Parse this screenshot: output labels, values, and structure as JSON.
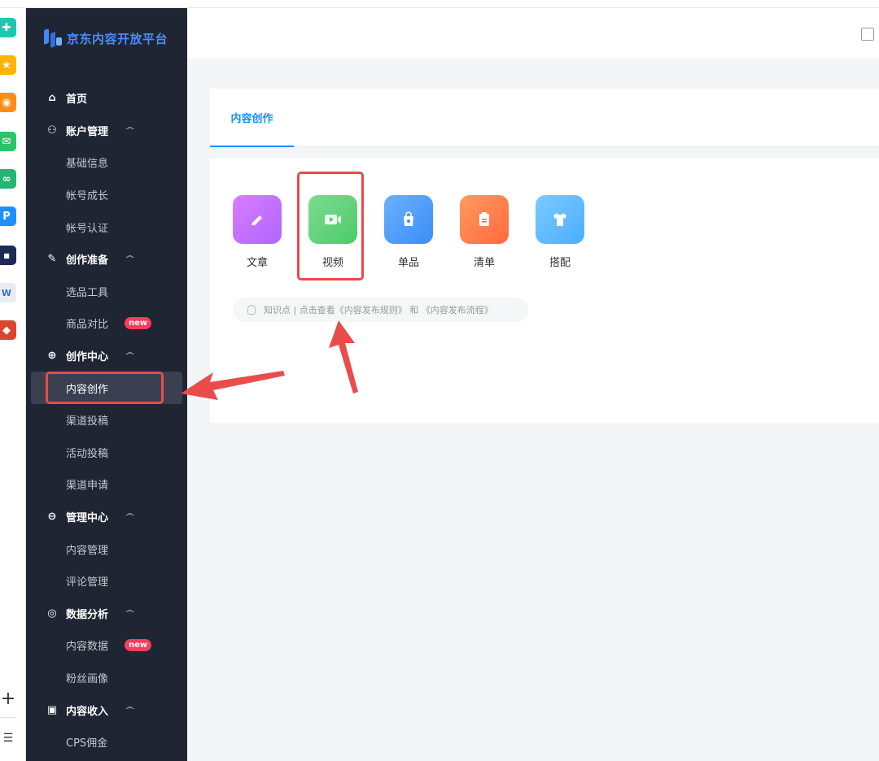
{
  "sidebar": {
    "logo_text": "京东内容开放平台",
    "nav": [
      {
        "type": "group",
        "label": "首页",
        "icon": "home-icon",
        "chevron": false
      },
      {
        "type": "group",
        "label": "账户管理",
        "icon": "user-icon",
        "chevron": true
      },
      {
        "type": "sub",
        "label": "基础信息"
      },
      {
        "type": "sub",
        "label": "帐号成长"
      },
      {
        "type": "sub",
        "label": "帐号认证"
      },
      {
        "type": "group",
        "label": "创作准备",
        "icon": "pen-icon",
        "chevron": true
      },
      {
        "type": "sub",
        "label": "选品工具"
      },
      {
        "type": "sub",
        "label": "商品对比",
        "badge": "new"
      },
      {
        "type": "group",
        "label": "创作中心",
        "icon": "plus-circle-icon",
        "chevron": true
      },
      {
        "type": "sub",
        "label": "内容创作",
        "active": true
      },
      {
        "type": "sub",
        "label": "渠道投稿"
      },
      {
        "type": "sub",
        "label": "活动投稿"
      },
      {
        "type": "sub",
        "label": "渠道申请"
      },
      {
        "type": "group",
        "label": "管理中心",
        "icon": "chat-icon",
        "chevron": true
      },
      {
        "type": "sub",
        "label": "内容管理"
      },
      {
        "type": "sub",
        "label": "评论管理"
      },
      {
        "type": "group",
        "label": "数据分析",
        "icon": "target-icon",
        "chevron": true
      },
      {
        "type": "sub",
        "label": "内容数据",
        "badge": "new"
      },
      {
        "type": "sub",
        "label": "粉丝画像"
      },
      {
        "type": "group",
        "label": "内容收入",
        "icon": "wallet-icon",
        "chevron": true
      },
      {
        "type": "sub",
        "label": "CPS佣金"
      }
    ]
  },
  "main": {
    "tab_label": "内容创作",
    "types": [
      {
        "label": "文章",
        "icon": "pencil-icon",
        "color_from": "#b066ff",
        "color_to": "#d97cff"
      },
      {
        "label": "视频",
        "icon": "video-icon",
        "color_from": "#4ccb6b",
        "color_to": "#7ddb8e"
      },
      {
        "label": "单品",
        "icon": "bag-icon",
        "color_from": "#3b8ef5",
        "color_to": "#6ab0ff"
      },
      {
        "label": "清单",
        "icon": "clipboard-icon",
        "color_from": "#ff6a3d",
        "color_to": "#ff9a5e"
      },
      {
        "label": "搭配",
        "icon": "shirt-icon",
        "color_from": "#4aaeff",
        "color_to": "#7ccaff"
      }
    ],
    "tip_text": "知识点 | 点击查看《内容发布规则》 和 《内容发布流程》"
  },
  "colors": {
    "accent": "#1a8cff",
    "sidebar_bg": "#1f2532",
    "highlight": "#ea4b4b"
  }
}
